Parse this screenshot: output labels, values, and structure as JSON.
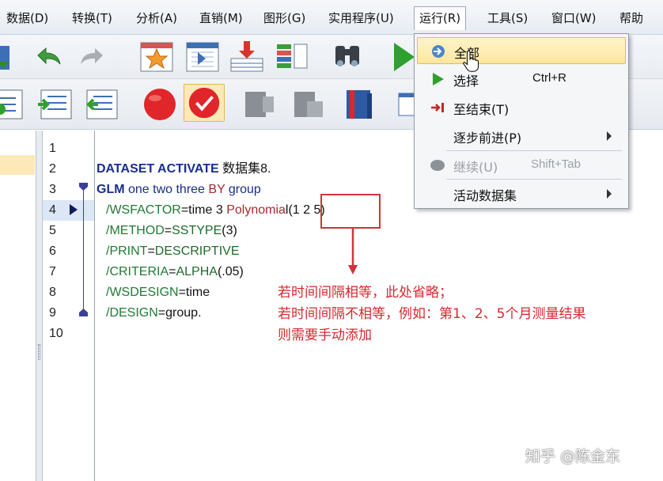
{
  "menubar": {
    "items": [
      "数据(D)",
      "转换(T)",
      "分析(A)",
      "直销(M)",
      "图形(G)",
      "实用程序(U)",
      "运行(R)",
      "工具(S)",
      "窗口(W)",
      "帮助"
    ]
  },
  "editor": {
    "line_numbers": [
      "1",
      "2",
      "3",
      "4",
      "5",
      "6",
      "7",
      "8",
      "9",
      "10"
    ],
    "line2": {
      "kw": "DATASET ACTIVATE",
      "rest": " 数据集8."
    },
    "line3": {
      "kw": "GLM",
      "a": " one two three ",
      "by": "BY",
      "b": " group"
    },
    "line4": {
      "cmd": "/WSFACTOR",
      "a": "=time 3 ",
      "red": "Polynomia",
      "b": "l(1 2 5)"
    },
    "line5": {
      "cmd": "/METHOD",
      "a": "=",
      "val": "SSTYPE",
      "b": "(3)"
    },
    "line6": {
      "cmd": "/PRINT",
      "a": "=",
      "val": "DESCRIPTIVE"
    },
    "line7": {
      "cmd": "/CRITERIA",
      "a": "=",
      "val": "ALPHA",
      "b": "(.05)"
    },
    "line8": {
      "cmd": "/WSDESIGN",
      "a": "=time"
    },
    "line9": {
      "cmd": "/DESIGN",
      "a": "=group."
    }
  },
  "annotation": {
    "line1": "若时间间隔相等，此处省略；",
    "line2": "若时间间隔不相等，例如：第1、2、5个月测量结果",
    "line3": "则需要手动添加"
  },
  "run_menu": {
    "items": [
      {
        "label": "全部",
        "shortcut": "",
        "icon": "run-all-icon"
      },
      {
        "label": "选择",
        "shortcut": "Ctrl+R",
        "icon": "play-icon"
      },
      {
        "label": "至结束(T)",
        "shortcut": "",
        "icon": "run-to-end-icon"
      },
      {
        "label": "逐步前进(P)",
        "shortcut": "",
        "icon": ""
      },
      {
        "label": "继续(U)",
        "shortcut": "Shift+Tab",
        "icon": "continue-icon"
      },
      {
        "label": "活动数据集",
        "shortcut": "",
        "icon": ""
      }
    ]
  },
  "watermark": "知乎 @陈金东",
  "colors": {
    "keyword": "#1a2e8a",
    "subcommand": "#1f7a34",
    "annotation": "#d9272e",
    "highlight": "#fde6a0"
  }
}
